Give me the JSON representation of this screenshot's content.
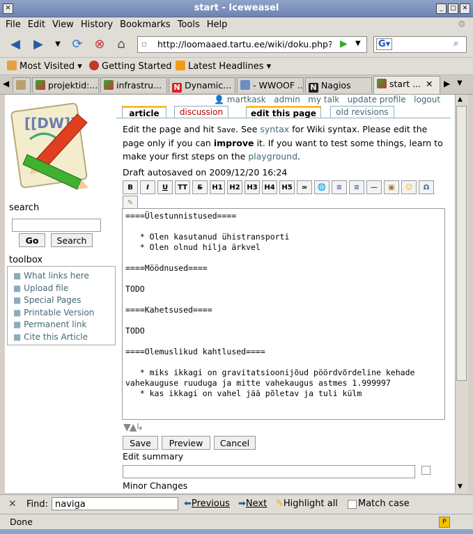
{
  "window": {
    "title": "start - Iceweasel"
  },
  "menu": [
    "File",
    "Edit",
    "View",
    "History",
    "Bookmarks",
    "Tools",
    "Help"
  ],
  "nav": {
    "url": "http://loomaaed.tartu.ee/wiki/doku.php?ic",
    "search_placeholder": ""
  },
  "bookmarks": [
    "Most Visited",
    "Getting Started",
    "Latest Headlines"
  ],
  "tabs": [
    {
      "label": "",
      "active": false
    },
    {
      "label": "projektid:...",
      "active": false
    },
    {
      "label": "infrastru...",
      "active": false
    },
    {
      "label": "Dynamic...",
      "active": false
    },
    {
      "label": "- WWOOF ...",
      "active": false
    },
    {
      "label": "Nagios",
      "active": false
    },
    {
      "label": "start ...",
      "active": true
    }
  ],
  "sidebar": {
    "search_label": "search",
    "go_label": "Go",
    "search_button": "Search",
    "toolbox_label": "toolbox",
    "toolbox_items": [
      "What links here",
      "Upload file",
      "Special Pages",
      "Printable Version",
      "Permanent link",
      "Cite this Article"
    ]
  },
  "user_links": [
    "martkask",
    "admin",
    "my talk",
    "update profile",
    "logout"
  ],
  "page_tabs": [
    "article",
    "discussion",
    "edit this page",
    "old revisions"
  ],
  "intro": {
    "p1": "Edit the page and hit ",
    "save_word": "Save",
    "p2": ". See ",
    "syntax_link": "syntax",
    "p3": " for Wiki syntax. Please edit the page only if you can ",
    "improve": "improve",
    "p4": " it. If you want to test some things, learn to make your first steps on the ",
    "playground": "playground",
    "p5": "."
  },
  "draft": "Draft autosaved on 2009/12/20 16:24",
  "toolbar_buttons": [
    "B",
    "I",
    "U",
    "TT",
    "S",
    "H1",
    "H2",
    "H3",
    "H4",
    "H5",
    "∞",
    "🌐",
    "≡",
    "≡",
    "—",
    "▣",
    "☺",
    "Ω",
    "✎"
  ],
  "editor_text": "====Ülestunnistused====\n\n   * Olen kasutanud ühistransporti\n   * Olen olnud hilja ärkvel\n\n====Möödnused====\n\nTODO\n\n====Kahetsused====\n\nTODO\n\n====Olemuslikud kahtlused====\n\n   * miks ikkagi on gravitatsioonijõud pöördvõrdeline kehade\nvahekauguse ruuduga ja mitte vahekaugus astmes 1.999997\n   * kas ikkagi on vahel jää põletav ja tuli külm",
  "buttons": {
    "save": "Save",
    "preview": "Preview",
    "cancel": "Cancel"
  },
  "edit_summary_label": "Edit summary",
  "minor_changes_label": "Minor Changes",
  "findbar": {
    "label": "Find:",
    "value": "naviga",
    "previous": "Previous",
    "next": "Next",
    "highlight": "Highlight all",
    "match_case": "Match case"
  },
  "status": "Done",
  "colors": {
    "link": "#436976",
    "accent": "#8cacbb"
  }
}
